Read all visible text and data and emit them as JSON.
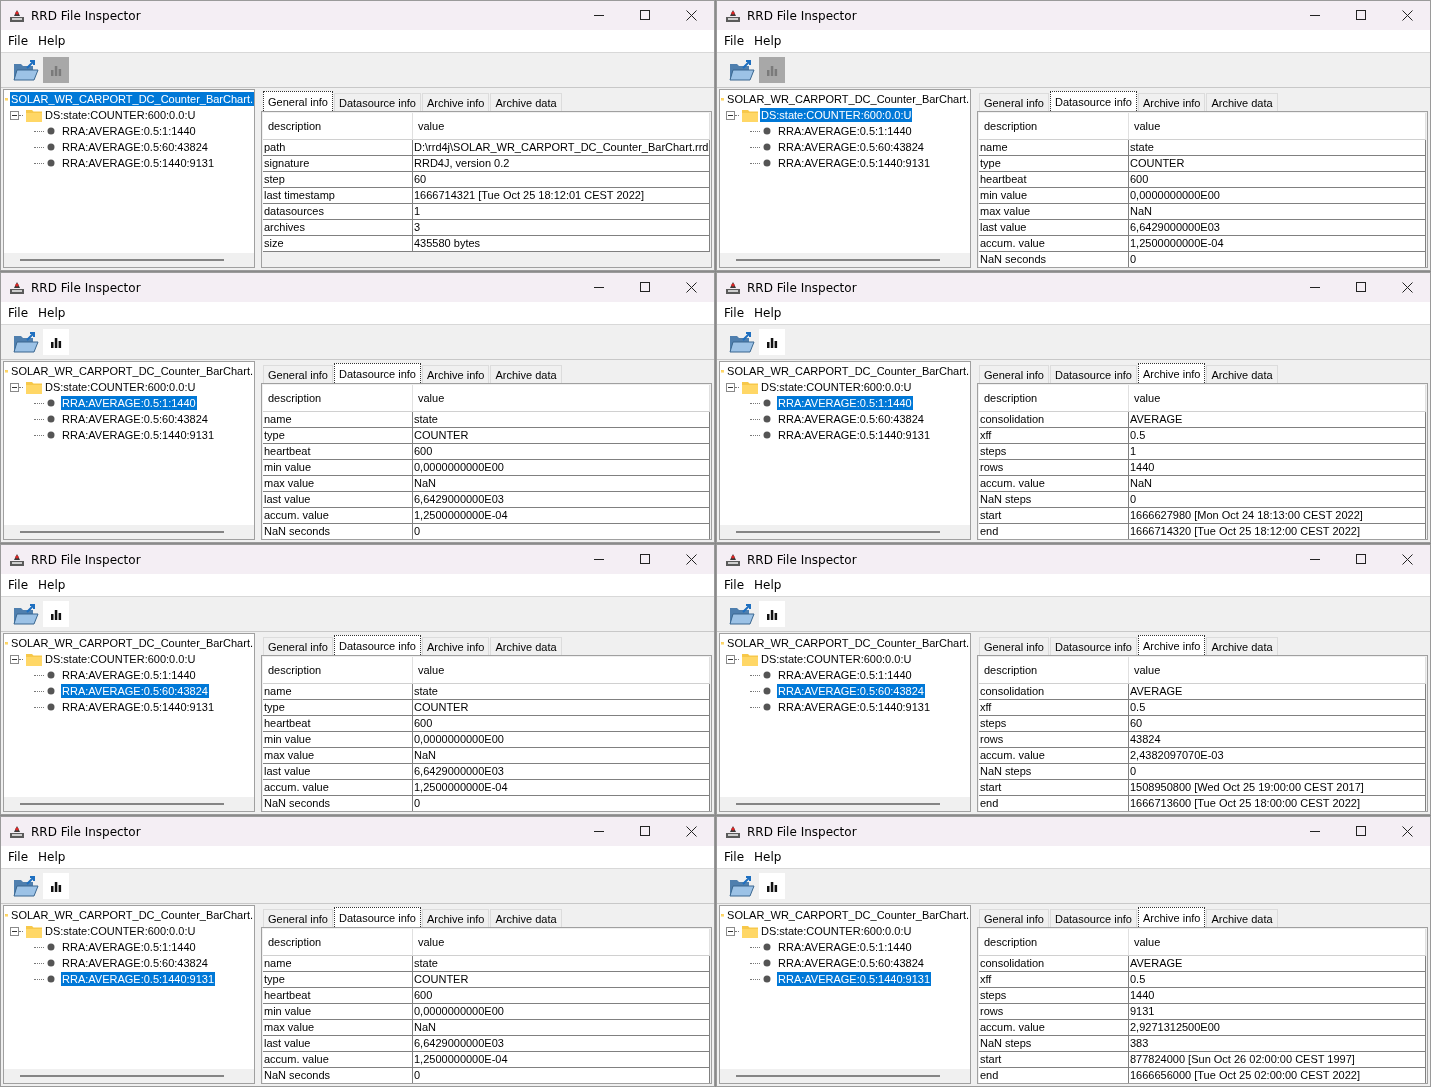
{
  "windows": [
    {
      "title": "RRD File Inspector",
      "menu": [
        "File",
        "Help"
      ],
      "toolbar": {
        "chart_disabled": true
      },
      "tree": {
        "label": "SOLAR_WR_CARPORT_DC_Counter_BarChart.",
        "selected": true,
        "children": [
          {
            "label": "DS:state:COUNTER:600:0.0:U",
            "selected": false,
            "expanded": true,
            "children": [
              {
                "label": "RRA:AVERAGE:0.5:1:1440",
                "selected": false
              },
              {
                "label": "RRA:AVERAGE:0.5:60:43824",
                "selected": false
              },
              {
                "label": "RRA:AVERAGE:0.5:1440:9131",
                "selected": false
              }
            ]
          }
        ]
      },
      "tabs": [
        {
          "label": "General info",
          "selected": true
        },
        {
          "label": "Datasource info",
          "selected": false
        },
        {
          "label": "Archive info",
          "selected": false
        },
        {
          "label": "Archive data",
          "selected": false
        }
      ],
      "table": {
        "columns": [
          "description",
          "value"
        ],
        "rows": [
          [
            "path",
            "D:\\rrd4j\\SOLAR_WR_CARPORT_DC_Counter_BarChart.rrd"
          ],
          [
            "signature",
            "RRD4J, version 0.2"
          ],
          [
            "step",
            "60"
          ],
          [
            "last timestamp",
            "1666714321 [Tue Oct 25 18:12:01 CEST 2022]"
          ],
          [
            "datasources",
            "1"
          ],
          [
            "archives",
            "3"
          ],
          [
            "size",
            "435580 bytes"
          ]
        ]
      }
    },
    {
      "title": "RRD File Inspector",
      "menu": [
        "File",
        "Help"
      ],
      "toolbar": {
        "chart_disabled": true
      },
      "tree": {
        "label": "SOLAR_WR_CARPORT_DC_Counter_BarChart.",
        "selected": false,
        "children": [
          {
            "label": "DS:state:COUNTER:600:0.0:U",
            "selected": true,
            "expanded": true,
            "children": [
              {
                "label": "RRA:AVERAGE:0.5:1:1440",
                "selected": false
              },
              {
                "label": "RRA:AVERAGE:0.5:60:43824",
                "selected": false
              },
              {
                "label": "RRA:AVERAGE:0.5:1440:9131",
                "selected": false
              }
            ]
          }
        ]
      },
      "tabs": [
        {
          "label": "General info",
          "selected": false
        },
        {
          "label": "Datasource info",
          "selected": true
        },
        {
          "label": "Archive info",
          "selected": false
        },
        {
          "label": "Archive data",
          "selected": false
        }
      ],
      "table": {
        "columns": [
          "description",
          "value"
        ],
        "rows": [
          [
            "name",
            "state"
          ],
          [
            "type",
            "COUNTER"
          ],
          [
            "heartbeat",
            "600"
          ],
          [
            "min value",
            "0,0000000000E00"
          ],
          [
            "max value",
            "NaN"
          ],
          [
            "last value",
            "6,6429000000E03"
          ],
          [
            "accum. value",
            "1,2500000000E-04"
          ],
          [
            "NaN seconds",
            "0"
          ]
        ]
      }
    },
    {
      "title": "RRD File Inspector",
      "menu": [
        "File",
        "Help"
      ],
      "toolbar": {
        "chart_disabled": false
      },
      "tree": {
        "label": "SOLAR_WR_CARPORT_DC_Counter_BarChart.",
        "selected": false,
        "children": [
          {
            "label": "DS:state:COUNTER:600:0.0:U",
            "selected": false,
            "expanded": true,
            "children": [
              {
                "label": "RRA:AVERAGE:0.5:1:1440",
                "selected": true
              },
              {
                "label": "RRA:AVERAGE:0.5:60:43824",
                "selected": false
              },
              {
                "label": "RRA:AVERAGE:0.5:1440:9131",
                "selected": false
              }
            ]
          }
        ]
      },
      "tabs": [
        {
          "label": "General info",
          "selected": false
        },
        {
          "label": "Datasource info",
          "selected": true
        },
        {
          "label": "Archive info",
          "selected": false
        },
        {
          "label": "Archive data",
          "selected": false
        }
      ],
      "table": {
        "columns": [
          "description",
          "value"
        ],
        "rows": [
          [
            "name",
            "state"
          ],
          [
            "type",
            "COUNTER"
          ],
          [
            "heartbeat",
            "600"
          ],
          [
            "min value",
            "0,0000000000E00"
          ],
          [
            "max value",
            "NaN"
          ],
          [
            "last value",
            "6,6429000000E03"
          ],
          [
            "accum. value",
            "1,2500000000E-04"
          ],
          [
            "NaN seconds",
            "0"
          ]
        ]
      }
    },
    {
      "title": "RRD File Inspector",
      "menu": [
        "File",
        "Help"
      ],
      "toolbar": {
        "chart_disabled": false
      },
      "tree": {
        "label": "SOLAR_WR_CARPORT_DC_Counter_BarChart.",
        "selected": false,
        "children": [
          {
            "label": "DS:state:COUNTER:600:0.0:U",
            "selected": false,
            "expanded": true,
            "children": [
              {
                "label": "RRA:AVERAGE:0.5:1:1440",
                "selected": true
              },
              {
                "label": "RRA:AVERAGE:0.5:60:43824",
                "selected": false
              },
              {
                "label": "RRA:AVERAGE:0.5:1440:9131",
                "selected": false
              }
            ]
          }
        ]
      },
      "tabs": [
        {
          "label": "General info",
          "selected": false
        },
        {
          "label": "Datasource info",
          "selected": false
        },
        {
          "label": "Archive info",
          "selected": true
        },
        {
          "label": "Archive data",
          "selected": false
        }
      ],
      "table": {
        "columns": [
          "description",
          "value"
        ],
        "rows": [
          [
            "consolidation",
            "AVERAGE"
          ],
          [
            "xff",
            "0.5"
          ],
          [
            "steps",
            "1"
          ],
          [
            "rows",
            "1440"
          ],
          [
            "accum. value",
            "NaN"
          ],
          [
            "NaN steps",
            "0"
          ],
          [
            "start",
            "1666627980 [Mon Oct 24 18:13:00 CEST 2022]"
          ],
          [
            "end",
            "1666714320 [Tue Oct 25 18:12:00 CEST 2022]"
          ]
        ]
      }
    },
    {
      "title": "RRD File Inspector",
      "menu": [
        "File",
        "Help"
      ],
      "toolbar": {
        "chart_disabled": false
      },
      "tree": {
        "label": "SOLAR_WR_CARPORT_DC_Counter_BarChart.",
        "selected": false,
        "children": [
          {
            "label": "DS:state:COUNTER:600:0.0:U",
            "selected": false,
            "expanded": true,
            "children": [
              {
                "label": "RRA:AVERAGE:0.5:1:1440",
                "selected": false
              },
              {
                "label": "RRA:AVERAGE:0.5:60:43824",
                "selected": true
              },
              {
                "label": "RRA:AVERAGE:0.5:1440:9131",
                "selected": false
              }
            ]
          }
        ]
      },
      "tabs": [
        {
          "label": "General info",
          "selected": false
        },
        {
          "label": "Datasource info",
          "selected": true
        },
        {
          "label": "Archive info",
          "selected": false
        },
        {
          "label": "Archive data",
          "selected": false
        }
      ],
      "table": {
        "columns": [
          "description",
          "value"
        ],
        "rows": [
          [
            "name",
            "state"
          ],
          [
            "type",
            "COUNTER"
          ],
          [
            "heartbeat",
            "600"
          ],
          [
            "min value",
            "0,0000000000E00"
          ],
          [
            "max value",
            "NaN"
          ],
          [
            "last value",
            "6,6429000000E03"
          ],
          [
            "accum. value",
            "1,2500000000E-04"
          ],
          [
            "NaN seconds",
            "0"
          ]
        ]
      }
    },
    {
      "title": "RRD File Inspector",
      "menu": [
        "File",
        "Help"
      ],
      "toolbar": {
        "chart_disabled": false
      },
      "tree": {
        "label": "SOLAR_WR_CARPORT_DC_Counter_BarChart.",
        "selected": false,
        "children": [
          {
            "label": "DS:state:COUNTER:600:0.0:U",
            "selected": false,
            "expanded": true,
            "children": [
              {
                "label": "RRA:AVERAGE:0.5:1:1440",
                "selected": false
              },
              {
                "label": "RRA:AVERAGE:0.5:60:43824",
                "selected": true
              },
              {
                "label": "RRA:AVERAGE:0.5:1440:9131",
                "selected": false
              }
            ]
          }
        ]
      },
      "tabs": [
        {
          "label": "General info",
          "selected": false
        },
        {
          "label": "Datasource info",
          "selected": false
        },
        {
          "label": "Archive info",
          "selected": true
        },
        {
          "label": "Archive data",
          "selected": false
        }
      ],
      "table": {
        "columns": [
          "description",
          "value"
        ],
        "rows": [
          [
            "consolidation",
            "AVERAGE"
          ],
          [
            "xff",
            "0.5"
          ],
          [
            "steps",
            "60"
          ],
          [
            "rows",
            "43824"
          ],
          [
            "accum. value",
            "2,4382097070E-03"
          ],
          [
            "NaN steps",
            "0"
          ],
          [
            "start",
            "1508950800 [Wed Oct 25 19:00:00 CEST 2017]"
          ],
          [
            "end",
            "1666713600 [Tue Oct 25 18:00:00 CEST 2022]"
          ]
        ]
      }
    },
    {
      "title": "RRD File Inspector",
      "menu": [
        "File",
        "Help"
      ],
      "toolbar": {
        "chart_disabled": false
      },
      "tree": {
        "label": "SOLAR_WR_CARPORT_DC_Counter_BarChart.",
        "selected": false,
        "children": [
          {
            "label": "DS:state:COUNTER:600:0.0:U",
            "selected": false,
            "expanded": true,
            "children": [
              {
                "label": "RRA:AVERAGE:0.5:1:1440",
                "selected": false
              },
              {
                "label": "RRA:AVERAGE:0.5:60:43824",
                "selected": false
              },
              {
                "label": "RRA:AVERAGE:0.5:1440:9131",
                "selected": true
              }
            ]
          }
        ]
      },
      "tabs": [
        {
          "label": "General info",
          "selected": false
        },
        {
          "label": "Datasource info",
          "selected": true
        },
        {
          "label": "Archive info",
          "selected": false
        },
        {
          "label": "Archive data",
          "selected": false
        }
      ],
      "table": {
        "columns": [
          "description",
          "value"
        ],
        "rows": [
          [
            "name",
            "state"
          ],
          [
            "type",
            "COUNTER"
          ],
          [
            "heartbeat",
            "600"
          ],
          [
            "min value",
            "0,0000000000E00"
          ],
          [
            "max value",
            "NaN"
          ],
          [
            "last value",
            "6,6429000000E03"
          ],
          [
            "accum. value",
            "1,2500000000E-04"
          ],
          [
            "NaN seconds",
            "0"
          ]
        ]
      }
    },
    {
      "title": "RRD File Inspector",
      "menu": [
        "File",
        "Help"
      ],
      "toolbar": {
        "chart_disabled": false
      },
      "tree": {
        "label": "SOLAR_WR_CARPORT_DC_Counter_BarChart.",
        "selected": false,
        "children": [
          {
            "label": "DS:state:COUNTER:600:0.0:U",
            "selected": false,
            "expanded": true,
            "children": [
              {
                "label": "RRA:AVERAGE:0.5:1:1440",
                "selected": false
              },
              {
                "label": "RRA:AVERAGE:0.5:60:43824",
                "selected": false
              },
              {
                "label": "RRA:AVERAGE:0.5:1440:9131",
                "selected": true
              }
            ]
          }
        ]
      },
      "tabs": [
        {
          "label": "General info",
          "selected": false
        },
        {
          "label": "Datasource info",
          "selected": false
        },
        {
          "label": "Archive info",
          "selected": true
        },
        {
          "label": "Archive data",
          "selected": false
        }
      ],
      "table": {
        "columns": [
          "description",
          "value"
        ],
        "rows": [
          [
            "consolidation",
            "AVERAGE"
          ],
          [
            "xff",
            "0.5"
          ],
          [
            "steps",
            "1440"
          ],
          [
            "rows",
            "9131"
          ],
          [
            "accum. value",
            "2,9271312500E00"
          ],
          [
            "NaN steps",
            "383"
          ],
          [
            "start",
            "877824000 [Sun Oct 26 02:00:00 CEST 1997]"
          ],
          [
            "end",
            "1666656000 [Tue Oct 25 02:00:00 CEST 2022]"
          ]
        ]
      }
    }
  ]
}
